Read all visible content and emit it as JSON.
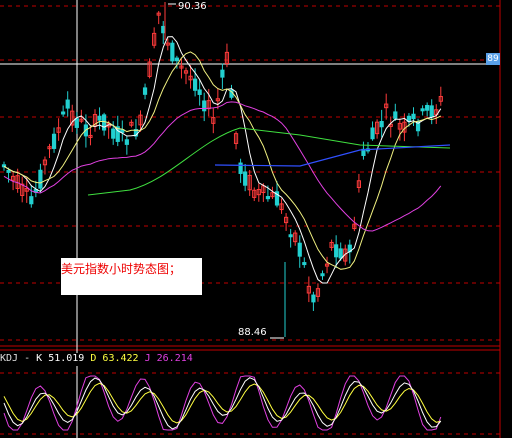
{
  "chart_data": {
    "type": "candlestick",
    "high_label": "90.36",
    "low_label": "88.46",
    "price_tag": "89",
    "annotation": "美元指数小时势态图；",
    "colors": {
      "up": "#ff3b3b",
      "down": "#22d0d0",
      "ma1": "#ffffff",
      "ma2": "#f0f080",
      "ma3": "#e040e0",
      "ma4": "#40e040",
      "ma5": "#3050ff",
      "grid": "#c00000",
      "k": "#ffffff",
      "d": "#ffff40",
      "j": "#e040e0"
    },
    "kdj": {
      "prefix": "KDJ -",
      "k_label": "K",
      "k_value": "51.019",
      "d_label": "D",
      "d_value": "63.422",
      "j_label": "J",
      "j_value": "26.214"
    }
  }
}
